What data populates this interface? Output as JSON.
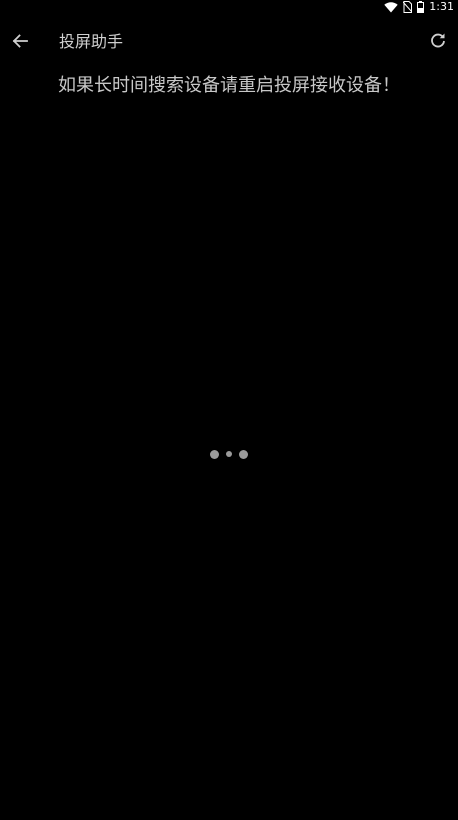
{
  "status_bar": {
    "time": "1:31",
    "icons": [
      "wifi-icon",
      "no-sim-icon",
      "battery-icon"
    ]
  },
  "toolbar": {
    "title": "投屏助手",
    "back_icon": "arrow-left-icon",
    "refresh_icon": "refresh-icon"
  },
  "main": {
    "hint": "如果长时间搜索设备请重启投屏接收设备！",
    "loading_icon": "loading-dots-icon"
  },
  "colors": {
    "background": "#000000",
    "text": "#cfcfcf",
    "dots": "#9a9a9a"
  }
}
